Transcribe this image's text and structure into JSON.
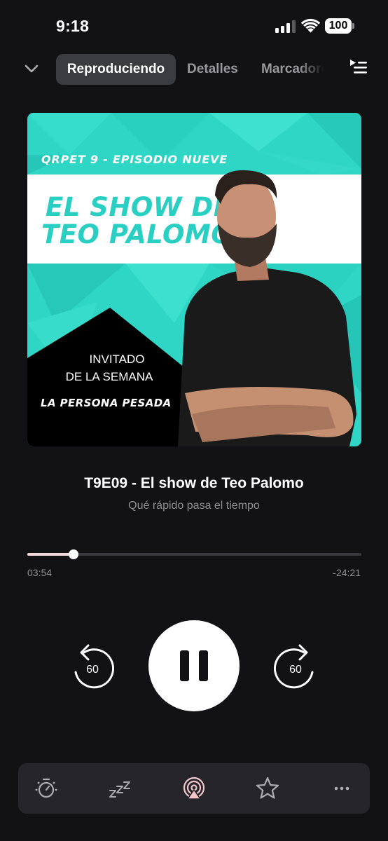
{
  "status_bar": {
    "time": "9:18",
    "battery": "100",
    "icons": [
      "signal-icon",
      "wifi-icon",
      "battery-icon"
    ]
  },
  "nav": {
    "collapse_icon": "chevron-down-icon",
    "tabs": [
      {
        "label": "Reproduciendo",
        "active": true
      },
      {
        "label": "Detalles",
        "active": false
      },
      {
        "label": "Marcadores",
        "active": false
      }
    ],
    "queue_icon": "play-queue-icon"
  },
  "artwork": {
    "season_text": "QRPET 9 - EPISODIO NUEVE",
    "title_line_1": "EL SHOW DE",
    "title_line_2": "TEO PALOMO",
    "guest_label_1": "INVITADO",
    "guest_label_2": "DE LA SEMANA",
    "guest_name": "LA PERSONA PESADA",
    "colors": {
      "background": "#2fd6c6",
      "title": "#28cfc2",
      "band": "#ffffff",
      "panel": "#000000"
    }
  },
  "episode": {
    "title": "T9E09 - El show de Teo Palomo",
    "subtitle": "Qué rápido pasa el tiempo"
  },
  "playback": {
    "elapsed": "03:54",
    "remaining": "-24:21",
    "progress_fraction": 0.138
  },
  "controls": {
    "skip_back": "60",
    "skip_forward": "60",
    "state": "playing",
    "icons": [
      "skip-back-icon",
      "pause-icon",
      "skip-forward-icon"
    ]
  },
  "toolbar": {
    "items": [
      "playback-speed-icon",
      "sleep-timer-icon",
      "airplay-icon",
      "star-icon",
      "more-icon"
    ]
  },
  "colors": {
    "background": "#121215",
    "tab_active_bg": "#3b3c40",
    "progress_fill": "#f0d8dc",
    "toolbar_bg": "#26262a",
    "secondary_text": "#8e8e93"
  }
}
